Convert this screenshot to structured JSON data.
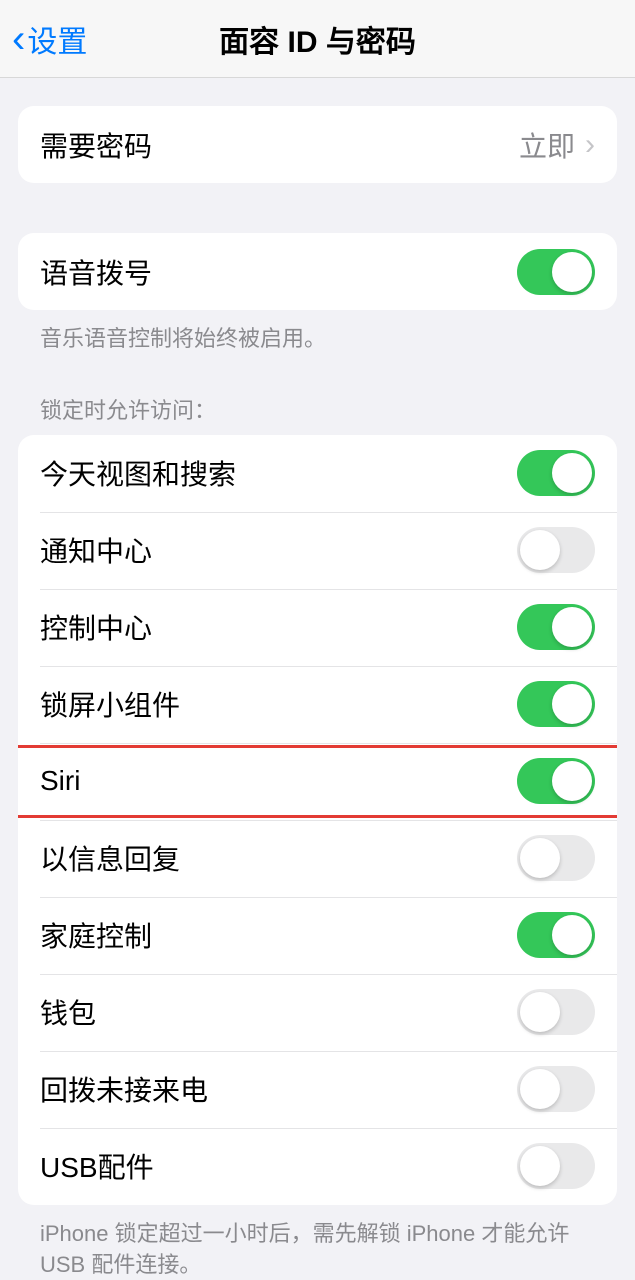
{
  "nav": {
    "back_label": "设置",
    "title": "面容 ID 与密码"
  },
  "passcode_group": {
    "require_label": "需要密码",
    "require_value": "立即"
  },
  "voice_dial": {
    "label": "语音拨号",
    "footer": "音乐语音控制将始终被启用。",
    "on": true
  },
  "lock_access": {
    "header": "锁定时允许访问：",
    "items": [
      {
        "label": "今天视图和搜索",
        "on": true
      },
      {
        "label": "通知中心",
        "on": false
      },
      {
        "label": "控制中心",
        "on": true
      },
      {
        "label": "锁屏小组件",
        "on": true
      },
      {
        "label": "Siri",
        "on": true
      },
      {
        "label": "以信息回复",
        "on": false
      },
      {
        "label": "家庭控制",
        "on": true
      },
      {
        "label": "钱包",
        "on": false
      },
      {
        "label": "回拨未接来电",
        "on": false
      },
      {
        "label": "USB配件",
        "on": false
      }
    ],
    "footer": "iPhone 锁定超过一小时后，需先解锁 iPhone 才能允许 USB 配件连接。"
  }
}
